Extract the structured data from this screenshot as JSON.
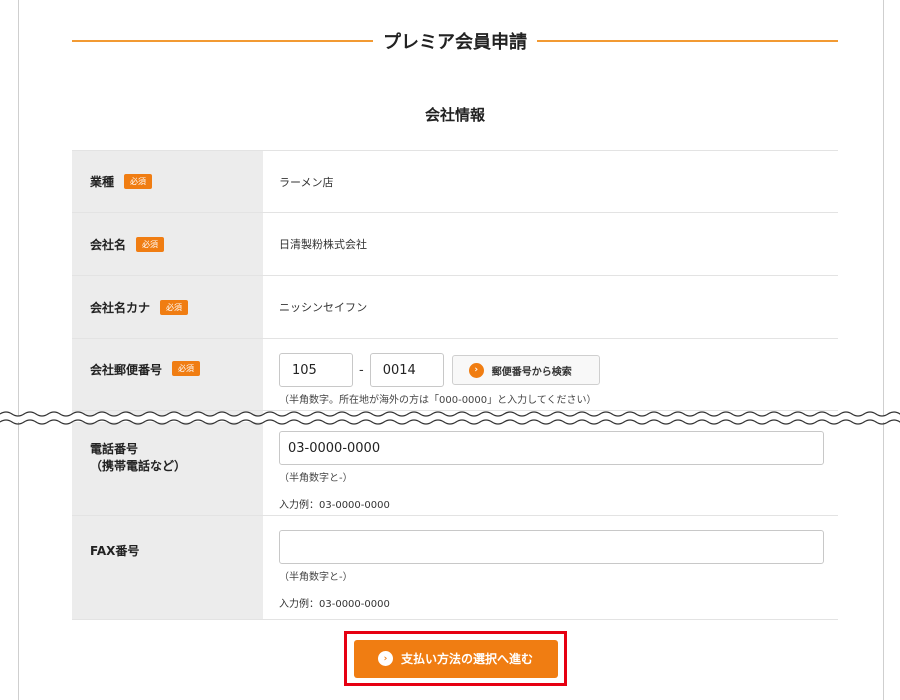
{
  "page": {
    "heading": "プレミア会員申請",
    "section_title": "会社情報"
  },
  "required_label": "必須",
  "fields": {
    "industry": {
      "label": "業種",
      "value": "ラーメン店"
    },
    "company_name": {
      "label": "会社名",
      "value": "日清製粉株式会社"
    },
    "company_kana": {
      "label": "会社名カナ",
      "value": "ニッシンセイフン"
    },
    "postal": {
      "label": "会社郵便番号",
      "part1": "105",
      "separator": "-",
      "part2": "0014",
      "search_button": "郵便番号から検索",
      "note": "（半角数字。所在地が海外の方は「000-0000」と入力してください）"
    },
    "phone": {
      "label_line1": "電話番号",
      "label_line2": "（携帯電話など）",
      "value": "03-0000-0000",
      "note": "（半角数字と-）",
      "example": "入力例：03-0000-0000"
    },
    "fax": {
      "label": "FAX番号",
      "value": "",
      "note": "（半角数字と-）",
      "example": "入力例：03-0000-0000"
    }
  },
  "submit_label": "支払い方法の選択へ進む",
  "icons": {
    "arrow": "chevron-right-icon"
  },
  "colors": {
    "accent": "#f07d12",
    "highlight": "#e60012",
    "rule": "#f29a33"
  }
}
